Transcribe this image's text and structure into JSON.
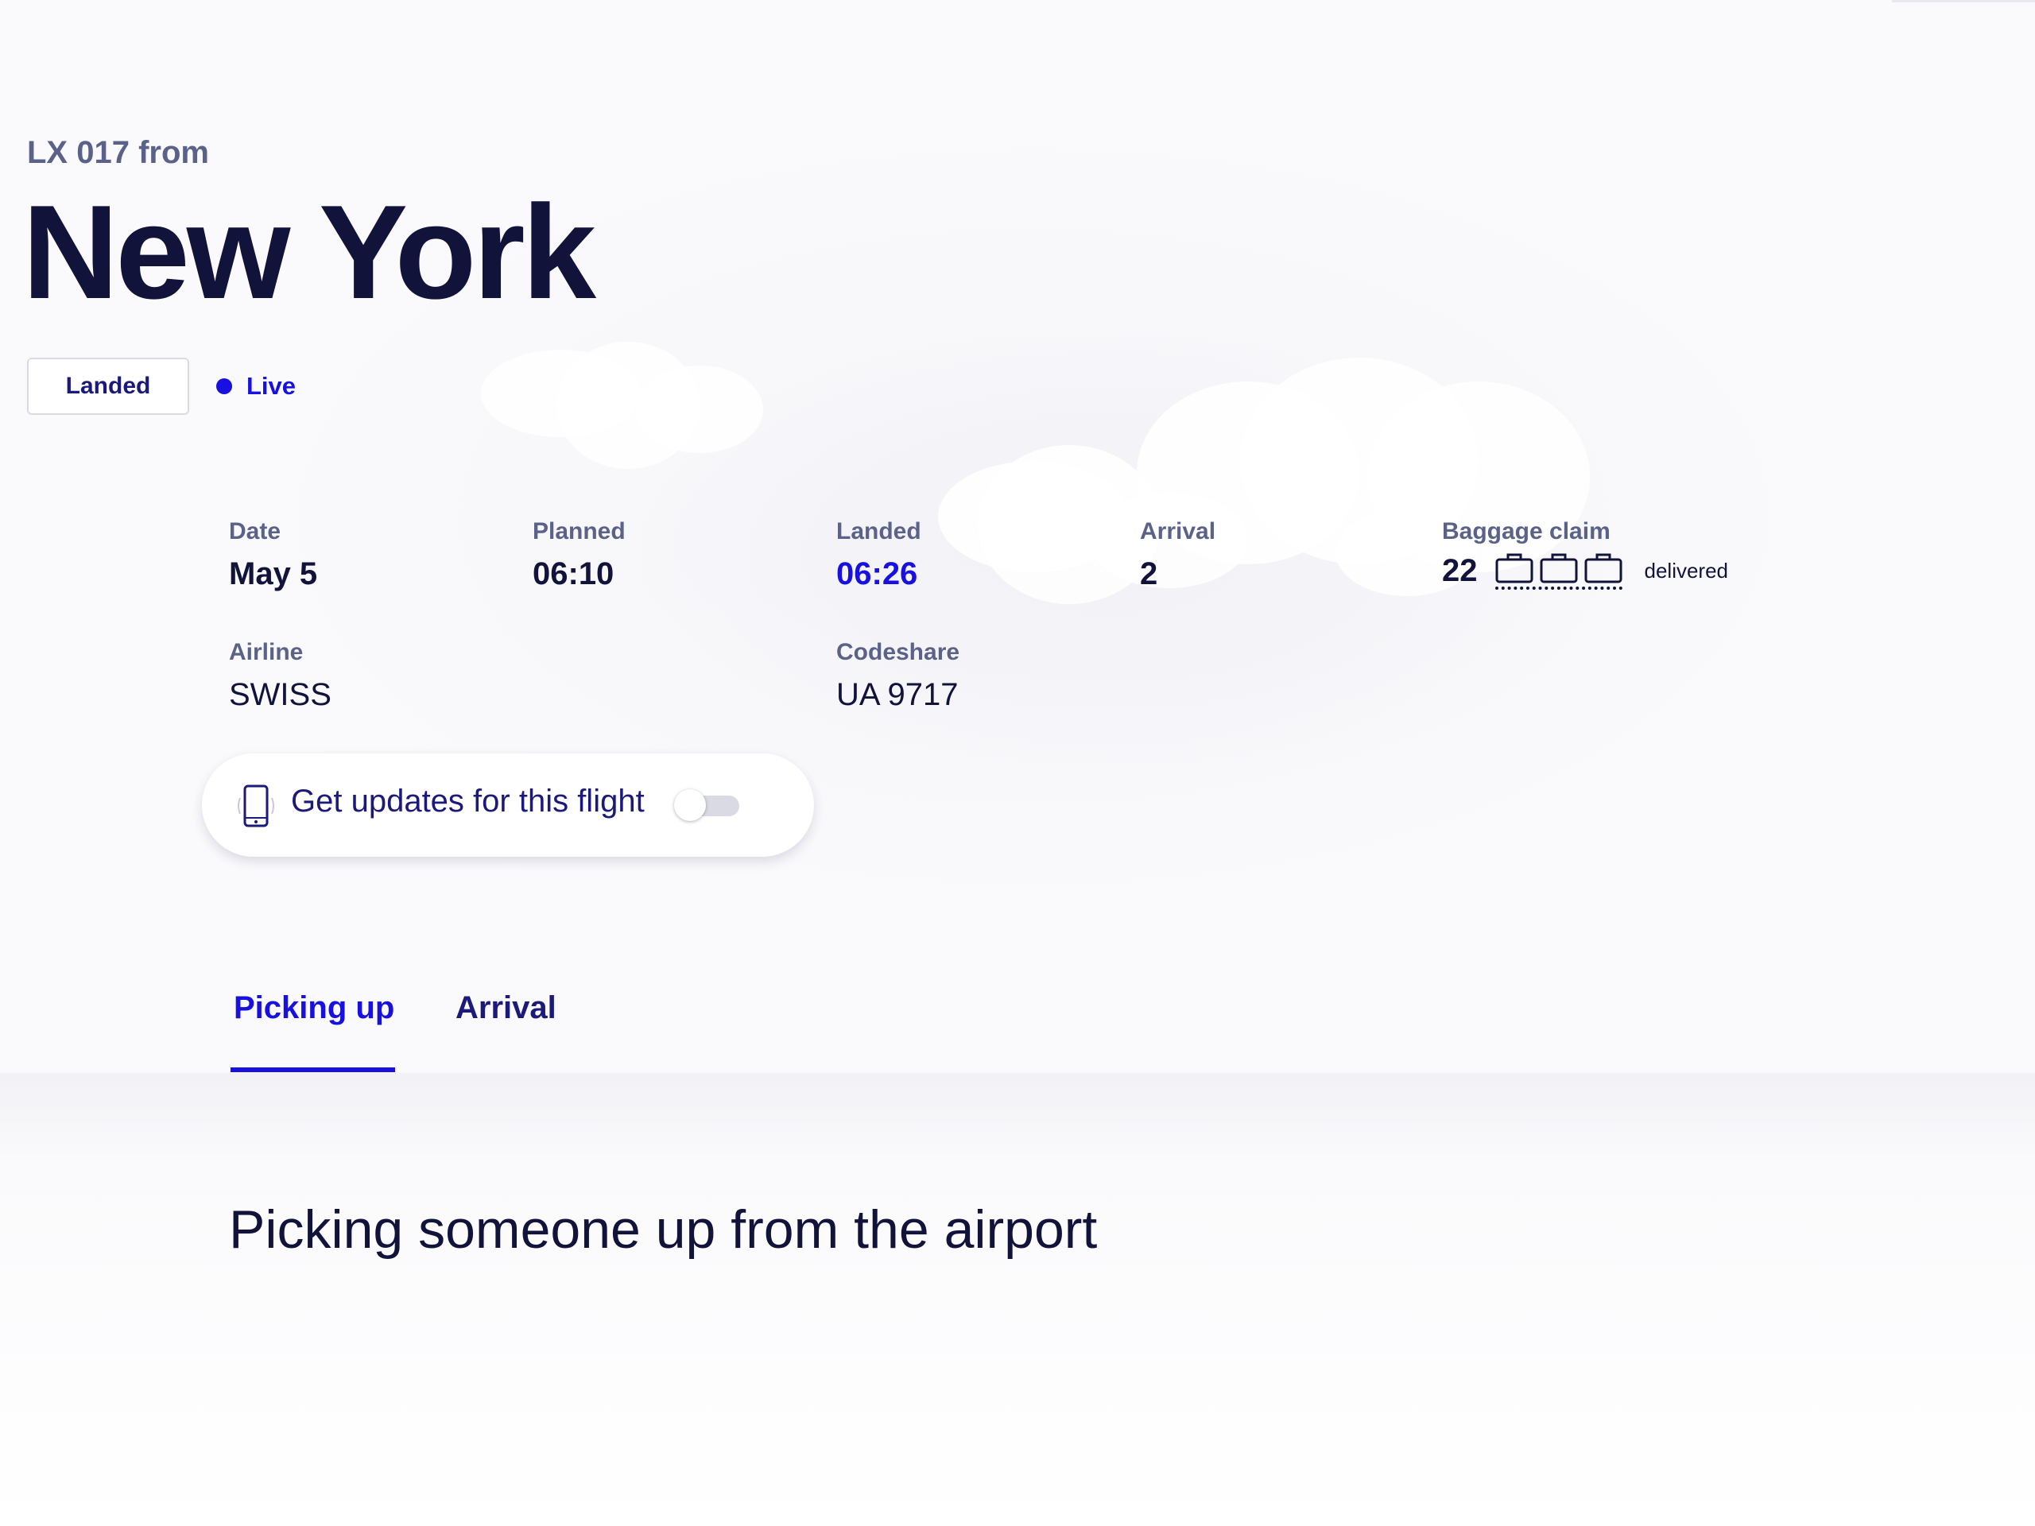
{
  "flight": {
    "subtitle": "LX 017 from",
    "city": "New York",
    "status": "Landed",
    "live_label": "Live"
  },
  "info": {
    "date": {
      "label": "Date",
      "value": "May 5"
    },
    "planned": {
      "label": "Planned",
      "value": "06:10"
    },
    "landed": {
      "label": "Landed",
      "value": "06:26"
    },
    "arrival": {
      "label": "Arrival",
      "value": "2"
    },
    "baggage": {
      "label": "Baggage claim",
      "value": "22",
      "status": "delivered",
      "bag_count": 3
    },
    "airline": {
      "label": "Airline",
      "value": "SWISS"
    },
    "codeshare": {
      "label": "Codeshare",
      "value": "UA 9717"
    }
  },
  "updates": {
    "label": "Get updates for this flight",
    "enabled": false
  },
  "tabs": [
    {
      "label": "Picking up",
      "active": true
    },
    {
      "label": "Arrival",
      "active": false
    }
  ],
  "section": {
    "heading": "Picking someone up from the airport"
  },
  "colors": {
    "accent": "#1710e0",
    "navy": "#12133b",
    "muted": "#5b6289"
  }
}
